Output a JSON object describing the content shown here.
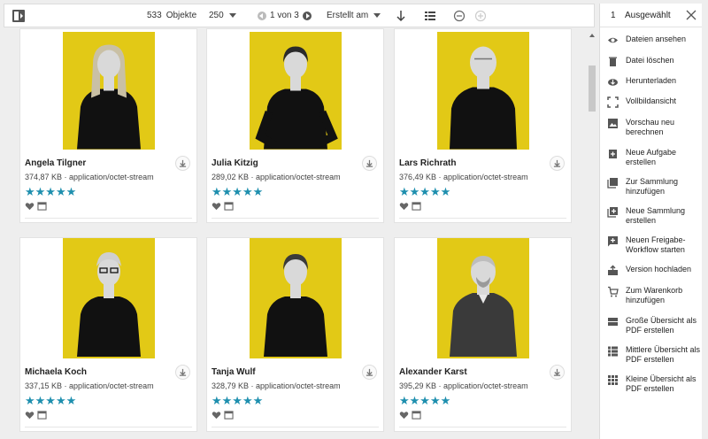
{
  "toolbar": {
    "object_count": "533",
    "object_label": "Objekte",
    "per_page": "250",
    "page_text": "1 von 3",
    "sort_label": "Erstellt am"
  },
  "cards": [
    {
      "name": "Angela Tilgner",
      "size": "374,87 KB",
      "type": "application/octet-stream",
      "stars": "★★★★★",
      "person": "woman-long-hair"
    },
    {
      "name": "Julia Kitzig",
      "size": "289,02 KB",
      "type": "application/octet-stream",
      "stars": "★★★★★",
      "person": "woman-hands-on-hips"
    },
    {
      "name": "Lars Richrath",
      "size": "376,49 KB",
      "type": "application/octet-stream",
      "stars": "★★★★★",
      "person": "man-bald"
    },
    {
      "name": "Michaela Koch",
      "size": "337,15 KB",
      "type": "application/octet-stream",
      "stars": "★★★★★",
      "person": "woman-glasses"
    },
    {
      "name": "Tanja Wulf",
      "size": "328,79 KB",
      "type": "application/octet-stream",
      "stars": "★★★★★",
      "person": "woman-short-hair"
    },
    {
      "name": "Alexander Karst",
      "size": "395,29 KB",
      "type": "application/octet-stream",
      "stars": "★★★★★",
      "person": "man-grey-shirt"
    }
  ],
  "meta_separator": "·",
  "panel": {
    "selected_count": "1",
    "selected_label": "Ausgewählt",
    "items": [
      {
        "label": "Dateien ansehen",
        "icon": "eye-icon"
      },
      {
        "label": "Datei löschen",
        "icon": "trash-icon"
      },
      {
        "label": "Herunterladen",
        "icon": "cloud-download-icon"
      },
      {
        "label": "Vollbildansicht",
        "icon": "fullscreen-icon"
      },
      {
        "label": "Vorschau neu berechnen",
        "icon": "image-icon"
      },
      {
        "label": "Neue Aufgabe erstellen",
        "icon": "task-add-icon"
      },
      {
        "label": "Zur Sammlung hinzufügen",
        "icon": "collection-icon"
      },
      {
        "label": "Neue Sammlung erstellen",
        "icon": "collection-add-icon"
      },
      {
        "label": "Neuen Freigabe-Workflow starten",
        "icon": "workflow-icon"
      },
      {
        "label": "Version hochladen",
        "icon": "upload-version-icon"
      },
      {
        "label": "Zum Warenkorb hinzufügen",
        "icon": "cart-add-icon"
      },
      {
        "label": "Große Übersicht als PDF erstellen",
        "icon": "large-list-icon"
      },
      {
        "label": "Mittlere Übersicht als PDF erstellen",
        "icon": "medium-list-icon"
      },
      {
        "label": "Kleine Übersicht als PDF erstellen",
        "icon": "small-grid-icon"
      }
    ]
  },
  "colors": {
    "accent_blue": "#1e8fae",
    "photo_yellow": "#e2c916",
    "background": "#eeeeee"
  }
}
